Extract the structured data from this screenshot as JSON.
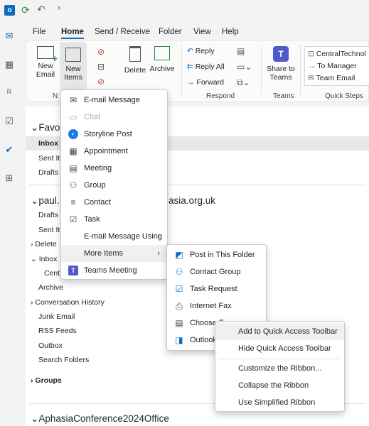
{
  "menubar": {
    "tabs": [
      "File",
      "Home",
      "Send / Receive",
      "Folder",
      "View",
      "Help"
    ],
    "active": "Home"
  },
  "ribbon": {
    "new_email": "New Email",
    "new_items": "New Items",
    "delete": "Delete",
    "archive": "Archive",
    "reply": "Reply",
    "reply_all": "Reply All",
    "forward": "Forward",
    "share_to_teams": "Share to Teams",
    "respond_label": "Respond",
    "teams_label": "Teams",
    "quick_steps_label": "Quick Steps",
    "new_label_partial": "N",
    "quick_steps": [
      "CentralTechnol",
      "To Manager",
      "Team Email"
    ]
  },
  "folders": {
    "favorites": "Favor",
    "inbox": "Inbox",
    "sent": "Sent It",
    "drafts": "Drafts",
    "account": "paul.",
    "account_suffix": "asia.org.uk",
    "acc_drafts": "Drafts",
    "acc_sent": "Sent It",
    "deleted": "Delete",
    "acc_inbox": "Inbox",
    "central": "Cent",
    "archive": "Archive",
    "conversation_history": "Conversation History",
    "junk": "Junk Email",
    "rss": "RSS Feeds",
    "outbox": "Outbox",
    "search_folders": "Search Folders",
    "groups": "Groups",
    "account2": "AphasiaConference2024Office"
  },
  "new_items_menu": {
    "items": [
      {
        "label": "E-mail Message",
        "icon": "mail-icon"
      },
      {
        "label": "Chat",
        "icon": "chat-icon",
        "disabled": true
      },
      {
        "label": "Storyline Post",
        "icon": "storyline-icon"
      },
      {
        "label": "Appointment",
        "icon": "calendar-icon"
      },
      {
        "label": "Meeting",
        "icon": "meeting-icon"
      },
      {
        "label": "Group",
        "icon": "group-icon"
      },
      {
        "label": "Contact",
        "icon": "contact-icon"
      },
      {
        "label": "Task",
        "icon": "task-icon"
      },
      {
        "label": "E-mail Message Using",
        "icon": "",
        "submenu": true
      },
      {
        "label": "More Items",
        "icon": "",
        "submenu": true
      },
      {
        "label": "Teams Meeting",
        "icon": "teams-icon"
      }
    ]
  },
  "more_items_menu": {
    "items": [
      {
        "label": "Post in This Folder",
        "icon": "post-icon"
      },
      {
        "label": "Contact Group",
        "icon": "contact-group-icon"
      },
      {
        "label": "Task Request",
        "icon": "task-request-icon"
      },
      {
        "label": "Internet Fax",
        "icon": "fax-icon"
      },
      {
        "label": "Choose F",
        "icon": "form-icon"
      },
      {
        "label": "Outlook",
        "icon": "outlook-data-icon"
      }
    ]
  },
  "context_menu": {
    "items": [
      "Add to Quick Access Toolbar",
      "Hide Quick Access Toolbar",
      "Customize the Ribbon...",
      "Collapse the Ribbon",
      "Use Simplified Ribbon"
    ]
  },
  "colors": {
    "accent": "#0f6cbd",
    "menu_bg": "#ffffff"
  }
}
